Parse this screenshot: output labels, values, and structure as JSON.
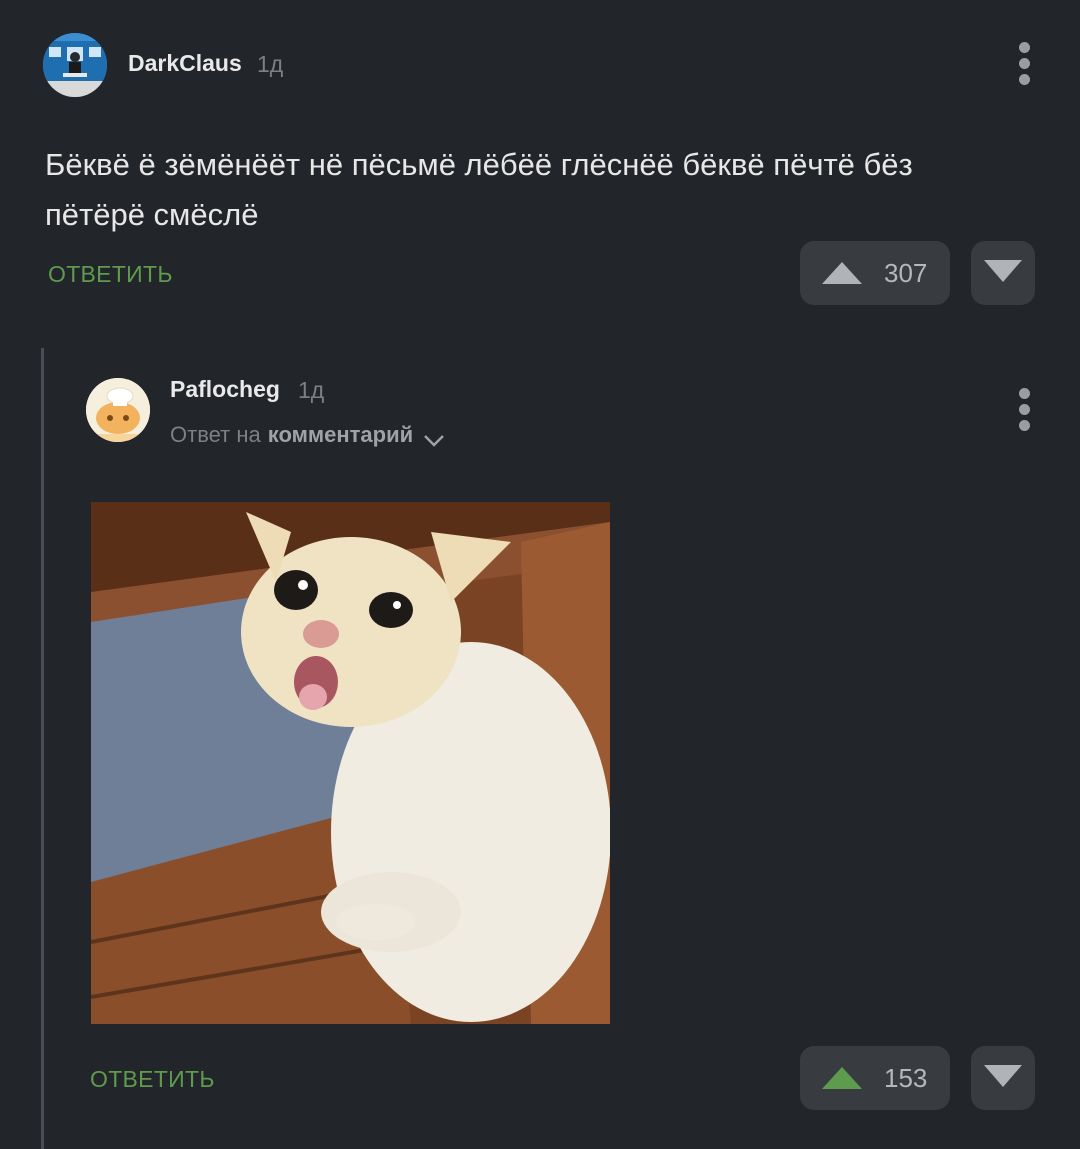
{
  "comment1": {
    "username": "DarkClaus",
    "time": "1д",
    "text": "Бёквё ё зёмёнёёт нё пёсьмё лёбёё глёснёё бёквё пёчтё бёз пётёрё смёслё",
    "reply_label": "ОТВЕТИТЬ",
    "rating": "307",
    "upvote_color": "#b0b3b7"
  },
  "comment2": {
    "username": "Paflocheg",
    "time": "1д",
    "reply_prefix": "Ответ на",
    "reply_target": "комментарий",
    "reply_label": "ОТВЕТИТЬ",
    "rating": "153",
    "upvote_color": "#5e9b4e"
  },
  "colors": {
    "background": "#222529",
    "accent_green": "#5e9b4e",
    "button_bg": "#383c41"
  }
}
